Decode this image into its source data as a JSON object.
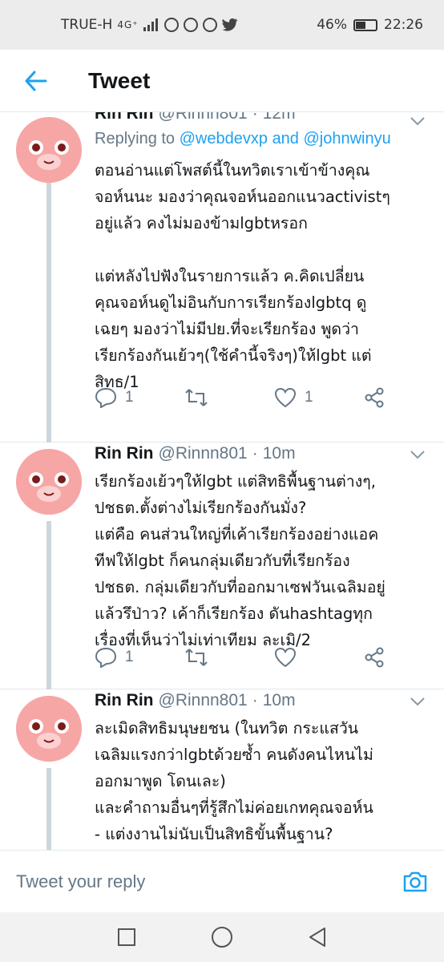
{
  "status_bar": {
    "carrier": "TRUE-H",
    "network": "4G⁺",
    "battery_percent": "46%",
    "battery_level": 0.46,
    "time": "22:26"
  },
  "header": {
    "title": "Tweet"
  },
  "tweets": [
    {
      "name": "Rin Rin",
      "handle": "@Rinnn801",
      "time": "12m",
      "replying_prefix": "Replying to",
      "replying_to_1": "@webdevxp",
      "replying_and": "and",
      "replying_to_2": "@johnwinyu",
      "text": "ตอนอ่านแต่โพสต์นี้ในทวิตเราเข้าข้างคุณ\nจอห์นนะ มองว่าคุณจอห์นออกแนวactivistๆ\nอยู่แล้ว คงไม่มองข้ามlgbtหรอก\n\nแต่หลังไปฟังในรายการแล้ว ค.คิดเปลี่ยน\nคุณจอห์นดูไม่อินกับการเรียกร้องlgbtq ดู\nเฉยๆ มองว่าไม่มีปย.ที่จะเรียกร้อง พูดว่า\nเรียกร้องกันเย้วๆ(ใช้คำนี้จริงๆ)ให้lgbt แต่\nสิทธ/1",
      "reply_count": "1",
      "like_count": "1"
    },
    {
      "name": "Rin Rin",
      "handle": "@Rinnn801",
      "time": "10m",
      "text": "เรียกร้องเย้วๆให้lgbt แต่สิทธิพื้นฐานต่างๆ,\nปชธต.ตั้งต่างไม่เรียกร้องกันมั่ง?\nแต่คือ คนส่วนใหญ่ที่เค้าเรียกร้องอย่างแอค\nทีฟให้lgbt ก็คนกลุ่มเดียวกับที่เรียกร้อง\nปชธต. กลุ่มเดียวกับที่ออกมาเซฟวันเฉลิมอยู่\nแล้วรึป่าว? เค้าก็เรียกร้อง ดันhashtagทุก\nเรื่องที่เห็นว่าไม่เท่าเทียม ละเมิ/2",
      "reply_count": "1",
      "like_count": ""
    },
    {
      "name": "Rin Rin",
      "handle": "@Rinnn801",
      "time": "10m",
      "text": "ละเมิดสิทธิมนุษยชน (ในทวิต กระแสวัน\nเฉลิมแรงกว่าlgbtด้วยซ้ำ คนดังคนไหนไม่\nออกมาพูด โดนเละ)\nและคำถามอื่นๆที่รู้สึกไม่ค่อยเกทคุณจอห์น\n- แต่งงานไม่นับเป็นสิทธิขั้นพื้นฐาน?\n- ทำไมถึงเรียกร้องเจาะจงเป็นเรื่องๆไปด้วย"
    }
  ],
  "reply_bar": {
    "placeholder": "Tweet your reply"
  },
  "colors": {
    "accent": "#1da1f2",
    "muted": "#657786",
    "avatar": "#f7a6a6"
  }
}
